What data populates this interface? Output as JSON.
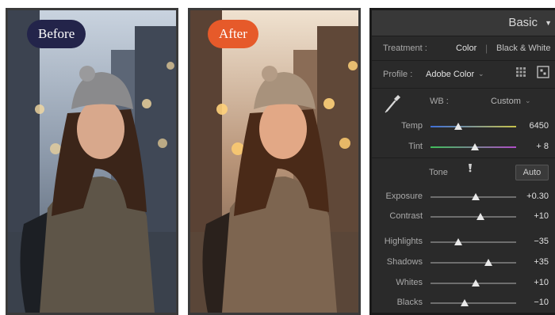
{
  "photos": {
    "before_label": "Before",
    "after_label": "After"
  },
  "panel": {
    "title": "Basic",
    "treatment": {
      "label": "Treatment :",
      "option_color": "Color",
      "option_bw": "Black & White"
    },
    "profile": {
      "label": "Profile :",
      "value": "Adobe Color"
    },
    "wb": {
      "label": "WB :",
      "value": "Custom"
    },
    "temp": {
      "label": "Temp",
      "value": "6450",
      "level": 0.32
    },
    "tint": {
      "label": "Tint",
      "value": "+ 8",
      "level": 0.52
    },
    "tone": {
      "label": "Tone",
      "auto_label": "Auto"
    },
    "sliders": [
      {
        "label": "Exposure",
        "value": "+0.30",
        "level": 0.53
      },
      {
        "label": "Contrast",
        "value": "+10",
        "level": 0.58
      },
      {
        "label": "Highlights",
        "value": "−35",
        "level": 0.32
      },
      {
        "label": "Shadows",
        "value": "+35",
        "level": 0.68
      },
      {
        "label": "Whites",
        "value": "+10",
        "level": 0.53
      },
      {
        "label": "Blacks",
        "value": "−10",
        "level": 0.4
      }
    ],
    "accent_color": "#e2e2e2"
  }
}
